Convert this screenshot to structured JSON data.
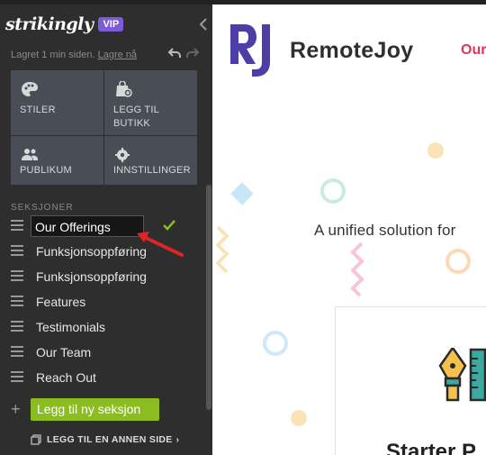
{
  "sidebar": {
    "brand": "strikingly",
    "badge": "VIP",
    "saved_text": "Lagret 1 min siden.",
    "undo_link": "Lagre nå",
    "tiles": [
      {
        "label": "STILER",
        "icon": "palette-icon"
      },
      {
        "label": "LEGG TIL BUTIKK",
        "icon": "shop-bag-icon"
      },
      {
        "label": "PUBLIKUM",
        "icon": "people-icon"
      },
      {
        "label": "INNSTILLINGER",
        "icon": "gear-icon"
      }
    ],
    "sections_title": "SEKSJONER",
    "sections": [
      {
        "label": "Our Offerings"
      },
      {
        "label": "Funksjonsoppføring"
      },
      {
        "label": "Funksjonsoppføring"
      },
      {
        "label": "Features"
      },
      {
        "label": "Testimonials"
      },
      {
        "label": "Our Team"
      },
      {
        "label": "Reach Out"
      }
    ],
    "add_section_label": "Legg til ny seksjon",
    "add_page_label": "LEGG TIL EN ANNEN SIDE",
    "add_page_chevron": "›"
  },
  "preview": {
    "logo_letters": "RJ",
    "site_name": "RemoteJoy",
    "nav_item": "Our",
    "tagline": "A unified solution for",
    "card_title": "Starter P",
    "colors": {
      "accent": "#e5335a",
      "logo_purple": "#4c3ea6",
      "logo_gold": "#f2c14e"
    }
  },
  "colors": {
    "sidebar_bg": "#2e2e2e",
    "tile_bg": "#484d56",
    "add_button": "#8bbd21",
    "badge": "#7b5bd6",
    "check": "#8bbd21",
    "arrow": "#e02424"
  }
}
